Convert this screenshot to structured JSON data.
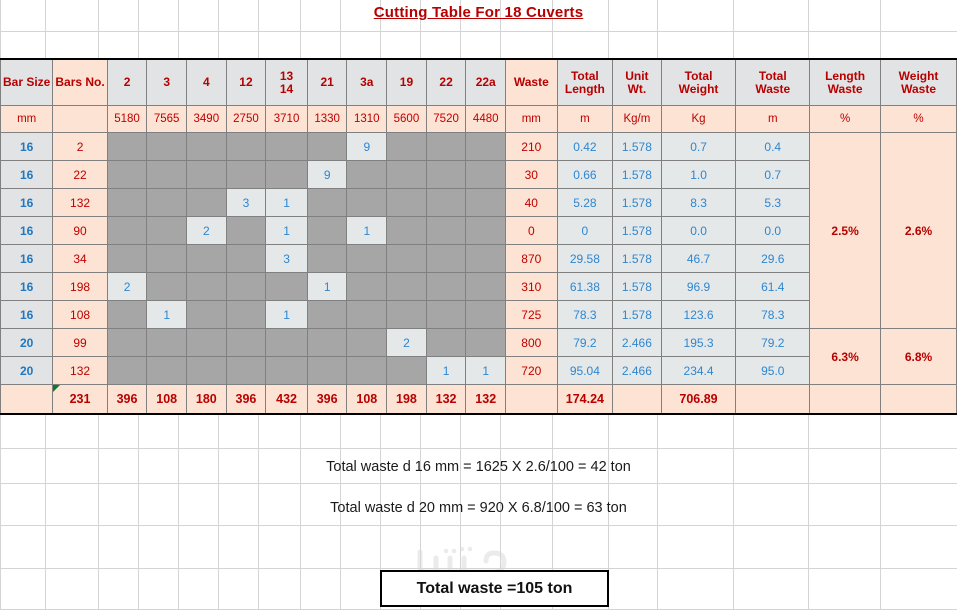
{
  "title": "Cutting Table For 18 Cuverts",
  "table": {
    "headers": {
      "bar_size": "Bar Size",
      "bars_no": "Bars No.",
      "marks": [
        "2",
        "3",
        "4",
        "12",
        "13 14",
        "21",
        "3a",
        "19",
        "22",
        "22a"
      ],
      "waste": "Waste",
      "total_length": "Total Length",
      "unit_wt": "Unit Wt.",
      "total_weight": "Total Weight",
      "total_waste": "Total Waste",
      "length_waste": "Length Waste",
      "weight_waste": "Weight Waste"
    },
    "units": {
      "bar_size": "mm",
      "bars_no": "",
      "marks": [
        "5180",
        "7565",
        "3490",
        "2750",
        "3710",
        "1330",
        "1310",
        "5600",
        "7520",
        "4480"
      ],
      "waste": "mm",
      "total_length": "m",
      "unit_wt": "Kg/m",
      "total_weight": "Kg",
      "total_waste": "m",
      "length_waste": "%",
      "weight_waste": "%"
    },
    "rows": [
      {
        "bar_size": "16",
        "bars_no": "2",
        "marks": [
          "",
          "",
          "",
          "",
          "",
          "",
          "9",
          "",
          "",
          ""
        ],
        "waste": "210",
        "total_length": "0.42",
        "unit_wt": "1.578",
        "total_weight": "0.7",
        "total_waste": "0.4"
      },
      {
        "bar_size": "16",
        "bars_no": "22",
        "marks": [
          "",
          "",
          "",
          "",
          "",
          "9",
          "",
          "",
          "",
          ""
        ],
        "waste": "30",
        "total_length": "0.66",
        "unit_wt": "1.578",
        "total_weight": "1.0",
        "total_waste": "0.7"
      },
      {
        "bar_size": "16",
        "bars_no": "132",
        "marks": [
          "",
          "",
          "",
          "3",
          "1",
          "",
          "",
          "",
          "",
          ""
        ],
        "waste": "40",
        "total_length": "5.28",
        "unit_wt": "1.578",
        "total_weight": "8.3",
        "total_waste": "5.3"
      },
      {
        "bar_size": "16",
        "bars_no": "90",
        "marks": [
          "",
          "",
          "2",
          "",
          "1",
          "",
          "1",
          "",
          "",
          ""
        ],
        "waste": "0",
        "total_length": "0",
        "unit_wt": "1.578",
        "total_weight": "0.0",
        "total_waste": "0.0"
      },
      {
        "bar_size": "16",
        "bars_no": "34",
        "marks": [
          "",
          "",
          "",
          "",
          "3",
          "",
          "",
          "",
          "",
          ""
        ],
        "waste": "870",
        "total_length": "29.58",
        "unit_wt": "1.578",
        "total_weight": "46.7",
        "total_waste": "29.6"
      },
      {
        "bar_size": "16",
        "bars_no": "198",
        "marks": [
          "2",
          "",
          "",
          "",
          "",
          "1",
          "",
          "",
          "",
          ""
        ],
        "waste": "310",
        "total_length": "61.38",
        "unit_wt": "1.578",
        "total_weight": "96.9",
        "total_waste": "61.4"
      },
      {
        "bar_size": "16",
        "bars_no": "108",
        "marks": [
          "",
          "1",
          "",
          "",
          "1",
          "",
          "",
          "",
          "",
          ""
        ],
        "waste": "725",
        "total_length": "78.3",
        "unit_wt": "1.578",
        "total_weight": "123.6",
        "total_waste": "78.3"
      },
      {
        "bar_size": "20",
        "bars_no": "99",
        "marks": [
          "",
          "",
          "",
          "",
          "",
          "",
          "",
          "2",
          "",
          ""
        ],
        "waste": "800",
        "total_length": "79.2",
        "unit_wt": "2.466",
        "total_weight": "195.3",
        "total_waste": "79.2"
      },
      {
        "bar_size": "20",
        "bars_no": "132",
        "marks": [
          "",
          "",
          "",
          "",
          "",
          "",
          "",
          "",
          "1",
          "1"
        ],
        "waste": "720",
        "total_length": "95.04",
        "unit_wt": "2.466",
        "total_weight": "234.4",
        "total_waste": "95.0"
      }
    ],
    "pct_groups": [
      {
        "rowspan": 7,
        "length_waste": "2.5%",
        "weight_waste": "2.6%"
      },
      {
        "rowspan": 2,
        "length_waste": "6.3%",
        "weight_waste": "6.8%"
      }
    ],
    "totals": {
      "bar_size": "",
      "bars_no": "231",
      "marks": [
        "396",
        "108",
        "180",
        "396",
        "432",
        "396",
        "108",
        "198",
        "132",
        "132"
      ],
      "waste": "",
      "total_length": "174.24",
      "unit_wt": "",
      "total_weight": "706.89",
      "total_waste": "",
      "length_waste": "",
      "weight_waste": ""
    }
  },
  "footer": {
    "line1": "Total waste d 16 mm = 1625 X 2.6/100 = 42 ton",
    "line2": "Total waste d 20 mm = 920 X 6.8/100 = 63 ton",
    "total_box": "Total waste =105 ton",
    "watermark": "مستقل"
  },
  "colors": {
    "title_red": "#b80000",
    "header_gray": "#e2e3e4",
    "peach": "#fce3d3",
    "slot_empty_gray": "#a6a6a6",
    "slot_filled_gray": "#e5e8e9",
    "value_blue": "#2e86d0",
    "value_red": "#c00000"
  }
}
